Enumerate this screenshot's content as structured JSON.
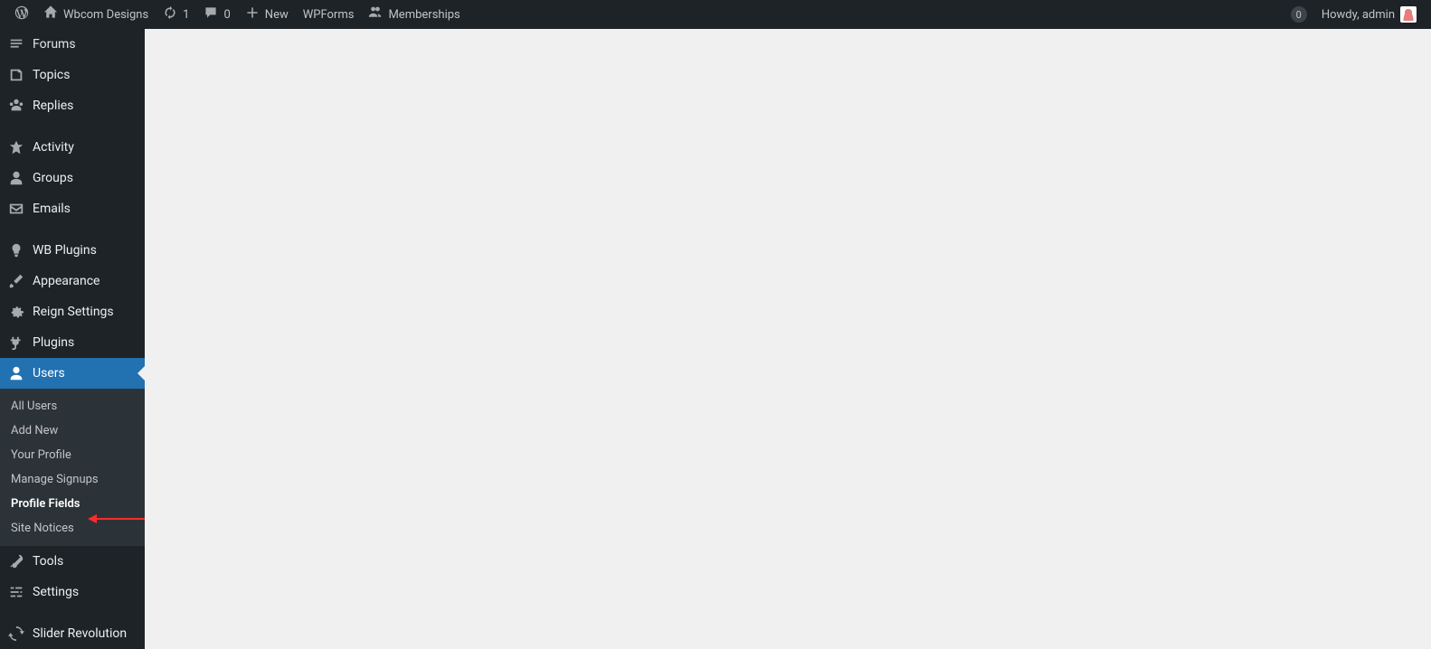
{
  "adminbar": {
    "site_name": "Wbcom Designs",
    "updates_count": "1",
    "comments_count": "0",
    "new_label": "New",
    "wpforms_label": "WPForms",
    "memberships_label": "Memberships",
    "notifications_count": "0",
    "greeting": "Howdy, admin"
  },
  "sidebar": {
    "items": [
      {
        "label": "Forums"
      },
      {
        "label": "Topics"
      },
      {
        "label": "Replies"
      },
      {
        "label": "Activity"
      },
      {
        "label": "Groups"
      },
      {
        "label": "Emails"
      },
      {
        "label": "WB Plugins"
      },
      {
        "label": "Appearance"
      },
      {
        "label": "Reign Settings"
      },
      {
        "label": "Plugins"
      },
      {
        "label": "Users"
      },
      {
        "label": "Tools"
      },
      {
        "label": "Settings"
      },
      {
        "label": "Slider Revolution"
      }
    ],
    "users_sub": [
      {
        "label": "All Users"
      },
      {
        "label": "Add New"
      },
      {
        "label": "Your Profile"
      },
      {
        "label": "Manage Signups"
      },
      {
        "label": "Profile Fields"
      },
      {
        "label": "Site Notices"
      }
    ]
  }
}
